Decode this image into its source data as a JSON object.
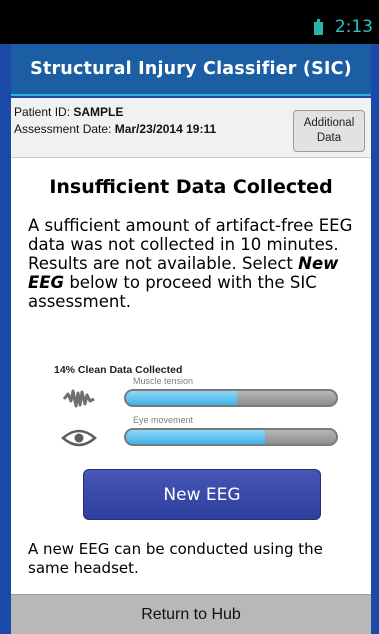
{
  "status": {
    "time": "2:13",
    "battery_icon": "battery-icon"
  },
  "app": {
    "title": "Structural Injury Classifier (SIC)"
  },
  "patient": {
    "id_label": "Patient ID: ",
    "id_value": "SAMPLE",
    "date_label": "Assessment Date: ",
    "date_value": "Mar/23/2014 19:11"
  },
  "additional_data_button": "Additional Data",
  "heading": "Insufficient Data Collected",
  "message": {
    "text1": "A sufficient amount of artifact-free EEG data was not collected in 10 minutes. Results are not available. Select ",
    "emphasis": "New EEG",
    "text2": " below to proceed with the SIC assessment."
  },
  "data_quality": {
    "title": "14% Clean Data Collected",
    "meters": [
      {
        "label": "Muscle tension",
        "icon": "muscle-icon",
        "fill": 0.53
      },
      {
        "label": "Eye movement",
        "icon": "eye-icon",
        "fill": 0.66
      }
    ]
  },
  "new_eeg_button": "New EEG",
  "note": "A new EEG can be conducted using the same headset.",
  "footer_button": "Return to Hub",
  "colors": {
    "background": "#1b4aa6",
    "titlebar": "#1c5ea3",
    "accent": "#2ab3e0",
    "primary_button": "#3a4aae"
  }
}
